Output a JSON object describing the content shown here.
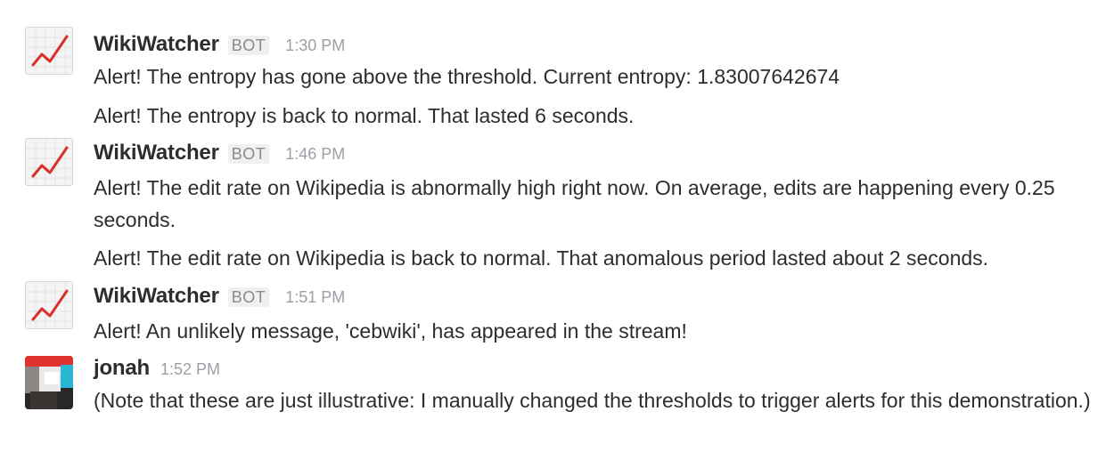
{
  "messages": [
    {
      "sender": "WikiWatcher",
      "badge": "BOT",
      "time": "1:30 PM",
      "lines": [
        "Alert! The entropy has gone above the threshold. Current entropy: 1.83007642674",
        "Alert! The entropy is back to normal. That lasted 6 seconds."
      ]
    },
    {
      "sender": "WikiWatcher",
      "badge": "BOT",
      "time": "1:46 PM",
      "lines": [
        "Alert! The edit rate on Wikipedia is abnormally high right now. On average, edits are happening every 0.25 seconds.",
        "Alert! The edit rate on Wikipedia is back to normal. That anomalous period lasted about 2 seconds."
      ]
    },
    {
      "sender": "WikiWatcher",
      "badge": "BOT",
      "time": "1:51 PM",
      "lines": [
        "Alert! An unlikely message, 'cebwiki', has appeared in the stream!"
      ]
    },
    {
      "sender": "jonah",
      "time": "1:52 PM",
      "lines": [
        "(Note that these are just illustrative: I manually changed the thresholds to trigger alerts for this demonstration.)"
      ]
    }
  ],
  "icons": {
    "bot_avatar": "chart-increasing-icon",
    "user_avatar": "user-avatar-icon"
  },
  "colors": {
    "chart_line": "#d9302b",
    "timestamp": "#9e9ea6",
    "user_avatar_red": "#e0322d",
    "user_avatar_cyan": "#29b6d6"
  }
}
